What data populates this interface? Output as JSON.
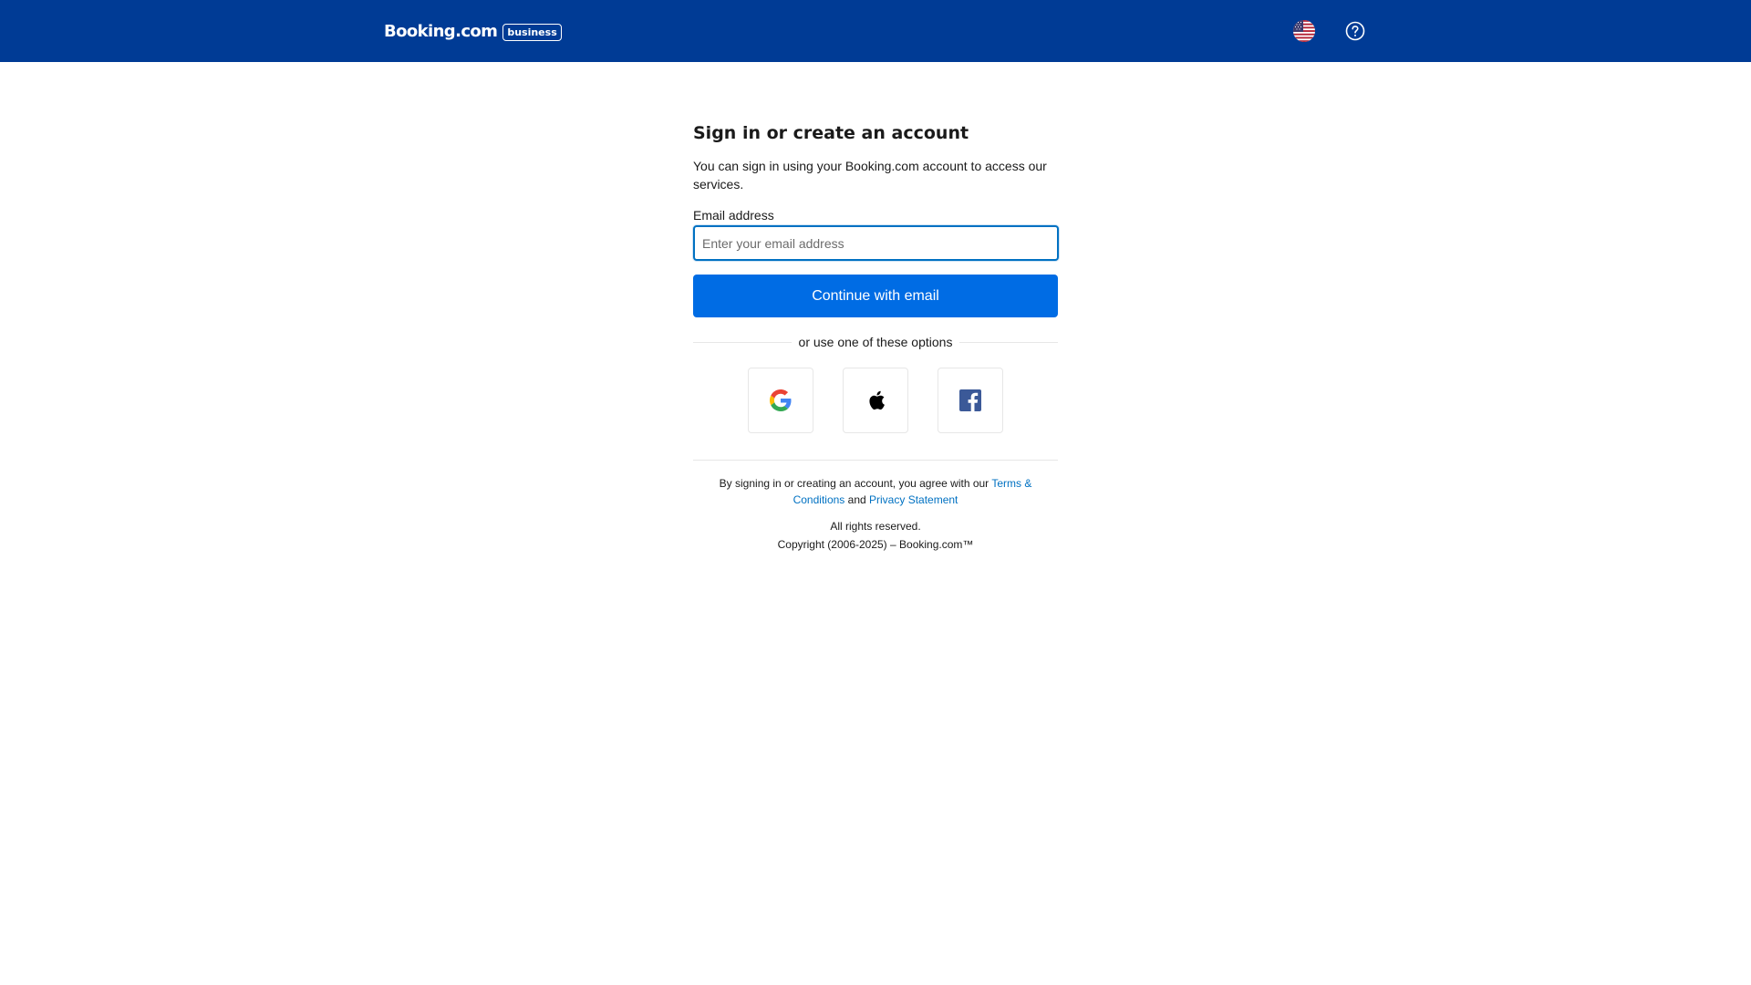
{
  "header": {
    "brand_name": "Booking.com",
    "brand_badge": "business",
    "language_icon": "us-flag-icon",
    "help_icon": "question-circle-icon",
    "background_color": "#003b95"
  },
  "signin": {
    "title": "Sign in or create an account",
    "subtitle": "You can sign in using your Booking.com account to access our services.",
    "email_label": "Email address",
    "email_value": "",
    "email_placeholder": "Enter your email address",
    "continue_label": "Continue with email",
    "divider_text": "or use one of these options",
    "social": [
      {
        "name": "google",
        "icon": "google-icon"
      },
      {
        "name": "apple",
        "icon": "apple-icon"
      },
      {
        "name": "facebook",
        "icon": "facebook-icon"
      }
    ],
    "accent_color": "#006ce4"
  },
  "legal": {
    "agreement_prefix": "By signing in or creating an account, you agree with our",
    "terms_link": "Terms & Conditions",
    "and_text": "and",
    "privacy_link": "Privacy Statement",
    "rights": "All rights reserved.",
    "copyright": "Copyright (2006-2025) – Booking.com™",
    "link_color": "#0071c2"
  }
}
